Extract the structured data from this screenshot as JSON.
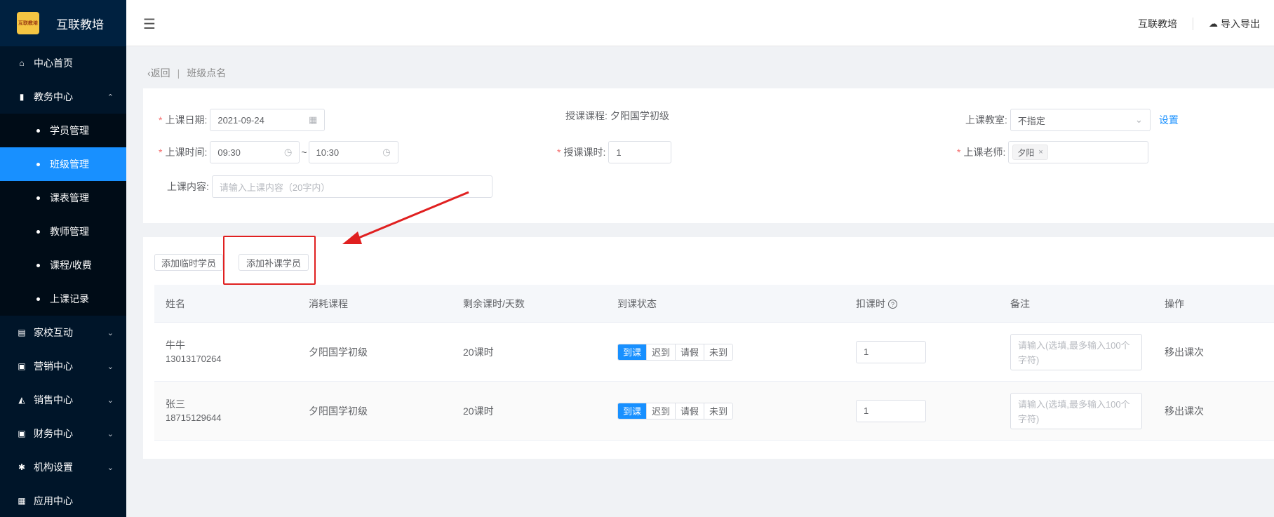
{
  "app": {
    "logo_text": "互联教培",
    "logo_mark": "互联教培"
  },
  "sidebar": {
    "items": [
      {
        "label": "中心首页",
        "icon": "home-icon"
      },
      {
        "label": "教务中心",
        "icon": "book-icon",
        "expanded": true
      },
      {
        "label": "家校互动",
        "icon": "chat-icon"
      },
      {
        "label": "营销中心",
        "icon": "bag-icon"
      },
      {
        "label": "销售中心",
        "icon": "sales-icon"
      },
      {
        "label": "财务中心",
        "icon": "wallet-icon"
      },
      {
        "label": "机构设置",
        "icon": "gear-icon"
      },
      {
        "label": "应用中心",
        "icon": "apps-icon"
      }
    ],
    "sub_items": [
      "学员管理",
      "班级管理",
      "课表管理",
      "教师管理",
      "课程/收费",
      "上课记录"
    ],
    "active_sub": "班级管理"
  },
  "header": {
    "org_name": "互联教培",
    "import_export": "导入导出"
  },
  "breadcrumb": {
    "back": "返回",
    "current": "班级点名"
  },
  "form": {
    "date_label": "上课日期:",
    "date_value": "2021-09-24",
    "course_label": "授课课程:",
    "course_value": "夕阳国学初级",
    "room_label": "上课教室:",
    "room_value": "不指定",
    "room_setting": "设置",
    "time_label": "上课时间:",
    "time_start": "09:30",
    "time_sep": "~",
    "time_end": "10:30",
    "hours_label": "授课课时:",
    "hours_value": "1",
    "teacher_label": "上课老师:",
    "teacher_tag": "夕阳",
    "content_label": "上课内容:",
    "content_placeholder": "请输入上课内容（20字内）"
  },
  "buttons": {
    "add_temp": "添加临时学员",
    "add_makeup": "添加补课学员"
  },
  "table": {
    "headers": [
      "姓名",
      "消耗课程",
      "剩余课时/天数",
      "到课状态",
      "扣课时",
      "备注",
      "操作"
    ],
    "status_options": [
      "到课",
      "迟到",
      "请假",
      "未到"
    ],
    "remark_placeholder": "请输入(选填,最多输入100个字符)",
    "rows": [
      {
        "name": "牛牛",
        "phone": "13013170264",
        "course": "夕阳国学初级",
        "remaining": "20课时",
        "status": "到课",
        "deduct": "1",
        "action": "移出课次"
      },
      {
        "name": "张三",
        "phone": "18715129644",
        "course": "夕阳国学初级",
        "remaining": "20课时",
        "status": "到课",
        "deduct": "1",
        "action": "移出课次"
      }
    ]
  },
  "colors": {
    "sidebar_bg": "#001529",
    "accent": "#1890ff",
    "highlight": "#e02020"
  }
}
